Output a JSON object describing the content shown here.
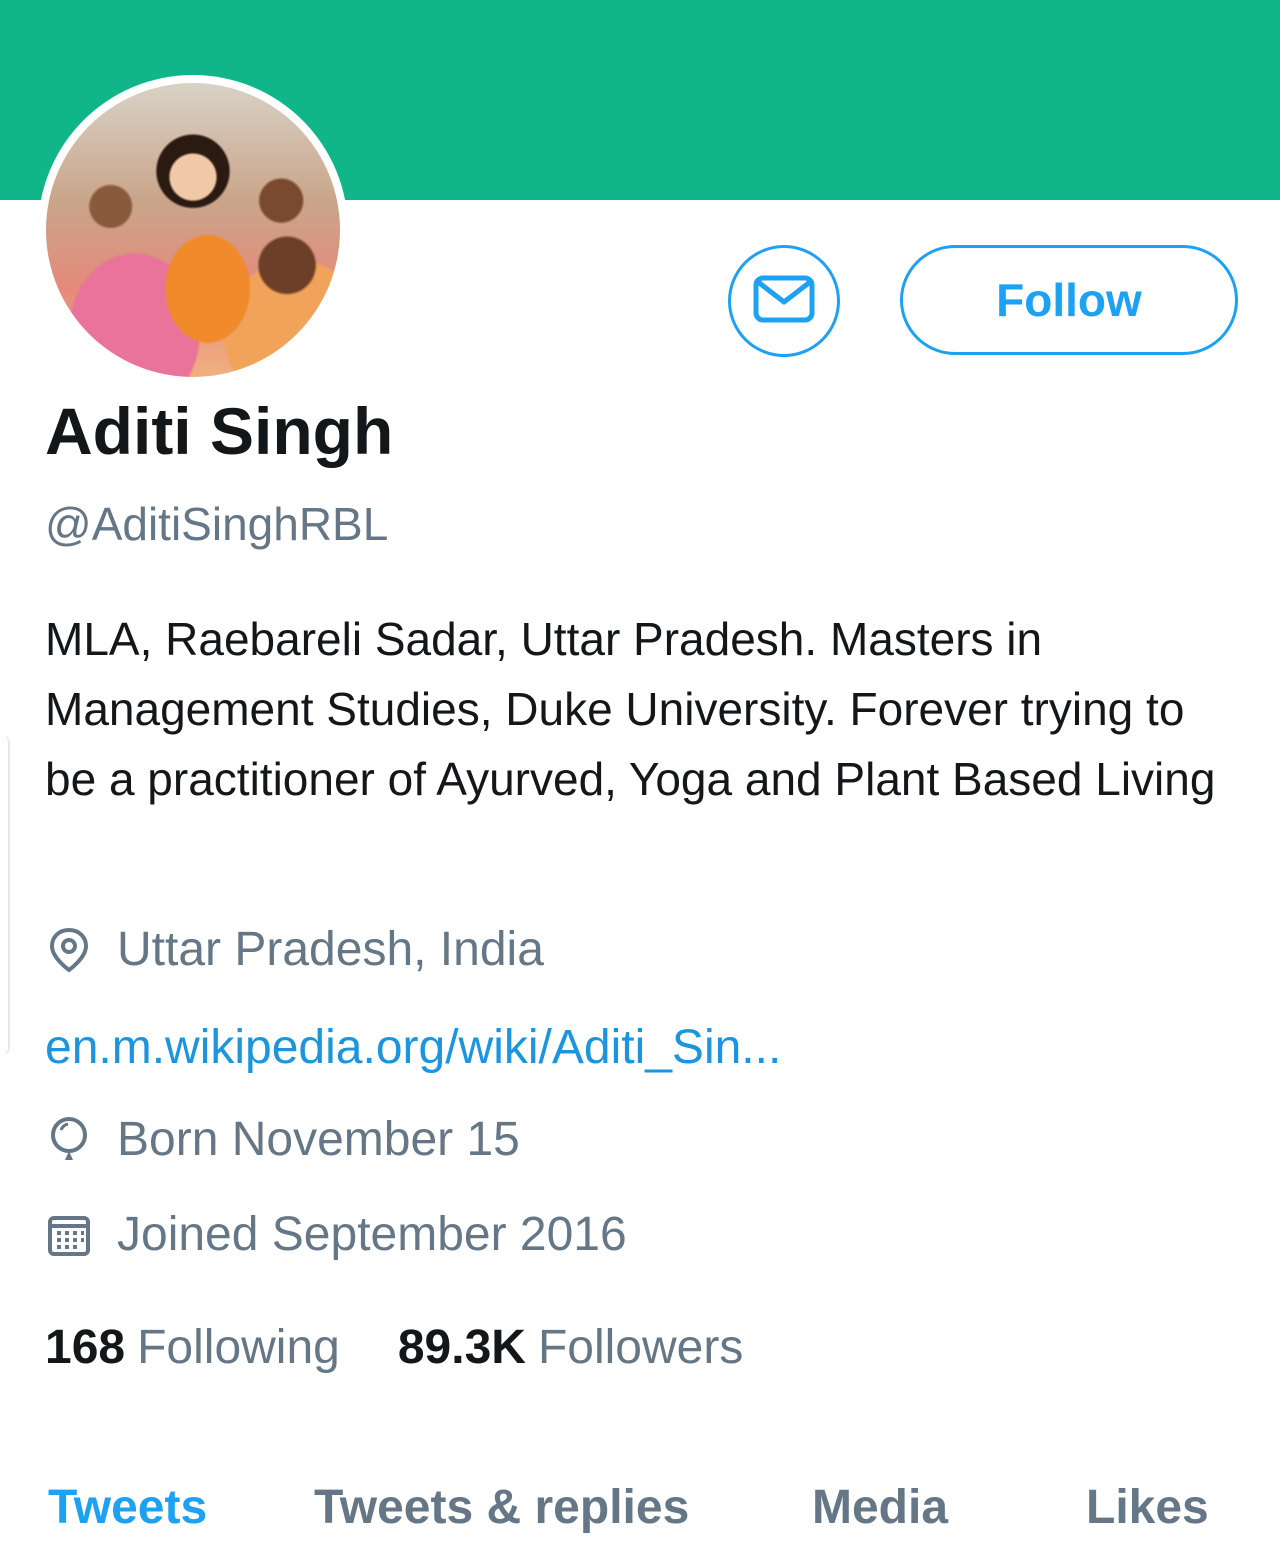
{
  "profile": {
    "name": "Aditi Singh",
    "handle": "@AditiSinghRBL",
    "bio": "MLA, Raebareli Sadar, Uttar Pradesh. Masters in Management Studies, Duke University. Forever trying to be a practitioner of Ayurved, Yoga and Plant Based Living",
    "location": "Uttar Pradesh, India",
    "url": "en.m.wikipedia.org/wiki/Aditi_Sin...",
    "born": "Born November 15",
    "joined": "Joined September 2016"
  },
  "actions": {
    "follow_label": "Follow",
    "message_icon": "envelope-icon"
  },
  "stats": {
    "following_count": "168",
    "following_label": "Following",
    "followers_count": "89.3K",
    "followers_label": "Followers"
  },
  "tabs": [
    {
      "label": "Tweets",
      "active": true
    },
    {
      "label": "Tweets & replies",
      "active": false
    },
    {
      "label": "Media",
      "active": false
    },
    {
      "label": "Likes",
      "active": false
    }
  ],
  "icons": {
    "location": "location-pin-icon",
    "birthday": "balloon-icon",
    "joined": "calendar-icon"
  },
  "colors": {
    "banner": "#10b589",
    "accent": "#1da1f2",
    "link": "#1b95e0",
    "secondary_text": "#657786",
    "primary_text": "#14171a"
  }
}
